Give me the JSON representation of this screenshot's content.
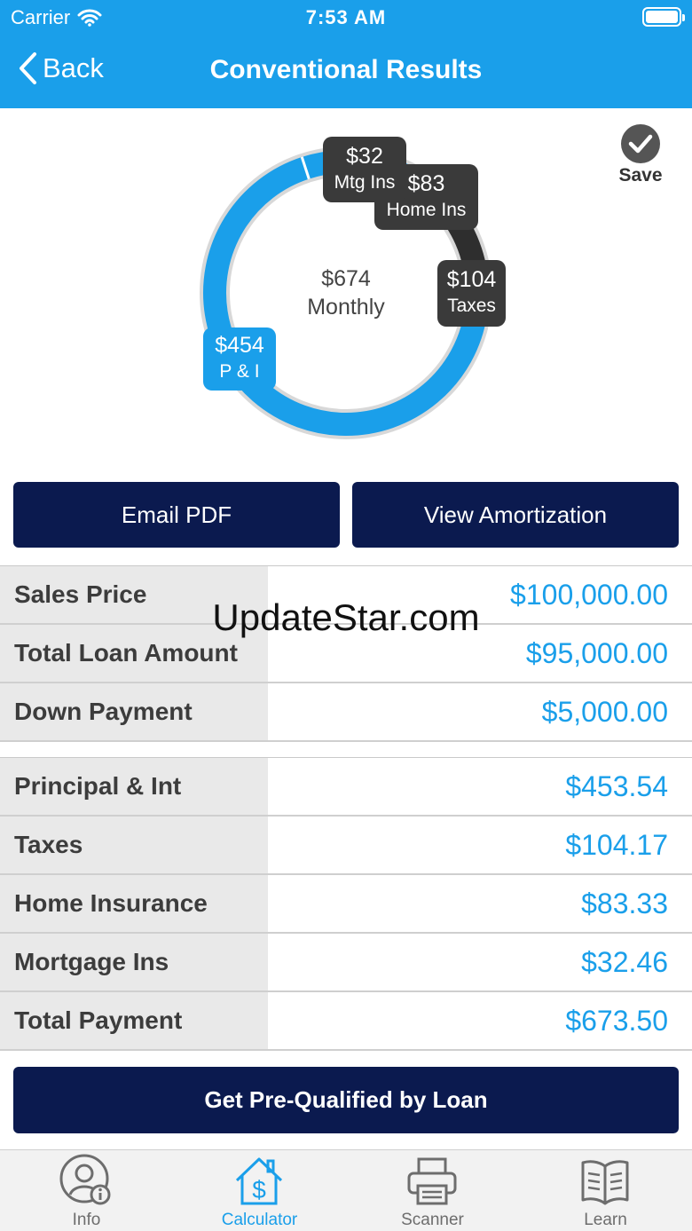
{
  "status_bar": {
    "carrier": "Carrier",
    "time": "7:53 AM"
  },
  "nav": {
    "back_label": "Back",
    "title": "Conventional Results"
  },
  "save_label": "Save",
  "chart_data": {
    "type": "pie",
    "center_value": "$674",
    "center_label": "Monthly",
    "slices": [
      {
        "value": 453.54,
        "color": "#1a9fea",
        "label_value": "$454",
        "label_name": "P & I"
      },
      {
        "value": 32.46,
        "color": "#1a9fea",
        "label_value": "$32",
        "label_name": "Mtg Ins"
      },
      {
        "value": 83.33,
        "color": "#1a9fea",
        "label_value": "$83",
        "label_name": "Home Ins"
      },
      {
        "value": 104.17,
        "color": "#2e2e2e",
        "label_value": "$104",
        "label_name": "Taxes"
      }
    ]
  },
  "buttons": {
    "email_pdf": "Email PDF",
    "view_amortization": "View Amortization",
    "prequalify": "Get Pre-Qualified by Loan"
  },
  "loan_table": [
    {
      "label": "Sales Price",
      "value": "$100,000.00"
    },
    {
      "label": "Total Loan Amount",
      "value": "$95,000.00"
    },
    {
      "label": "Down Payment",
      "value": "$5,000.00"
    }
  ],
  "payment_table": [
    {
      "label": "Principal & Int",
      "value": "$453.54"
    },
    {
      "label": "Taxes",
      "value": "$104.17"
    },
    {
      "label": "Home Insurance",
      "value": "$83.33"
    },
    {
      "label": "Mortgage Ins",
      "value": "$32.46"
    },
    {
      "label": "Total Payment",
      "value": "$673.50"
    }
  ],
  "watermark": "UpdateStar.com",
  "tabs": [
    {
      "label": "Info",
      "icon": "user-info-icon",
      "active": false
    },
    {
      "label": "Calculator",
      "icon": "house-dollar-icon",
      "active": true
    },
    {
      "label": "Scanner",
      "icon": "printer-icon",
      "active": false
    },
    {
      "label": "Learn",
      "icon": "book-icon",
      "active": false
    }
  ],
  "colors": {
    "accent": "#1a9fea",
    "navy": "#0b1a4f",
    "dark_slice": "#2e2e2e"
  }
}
